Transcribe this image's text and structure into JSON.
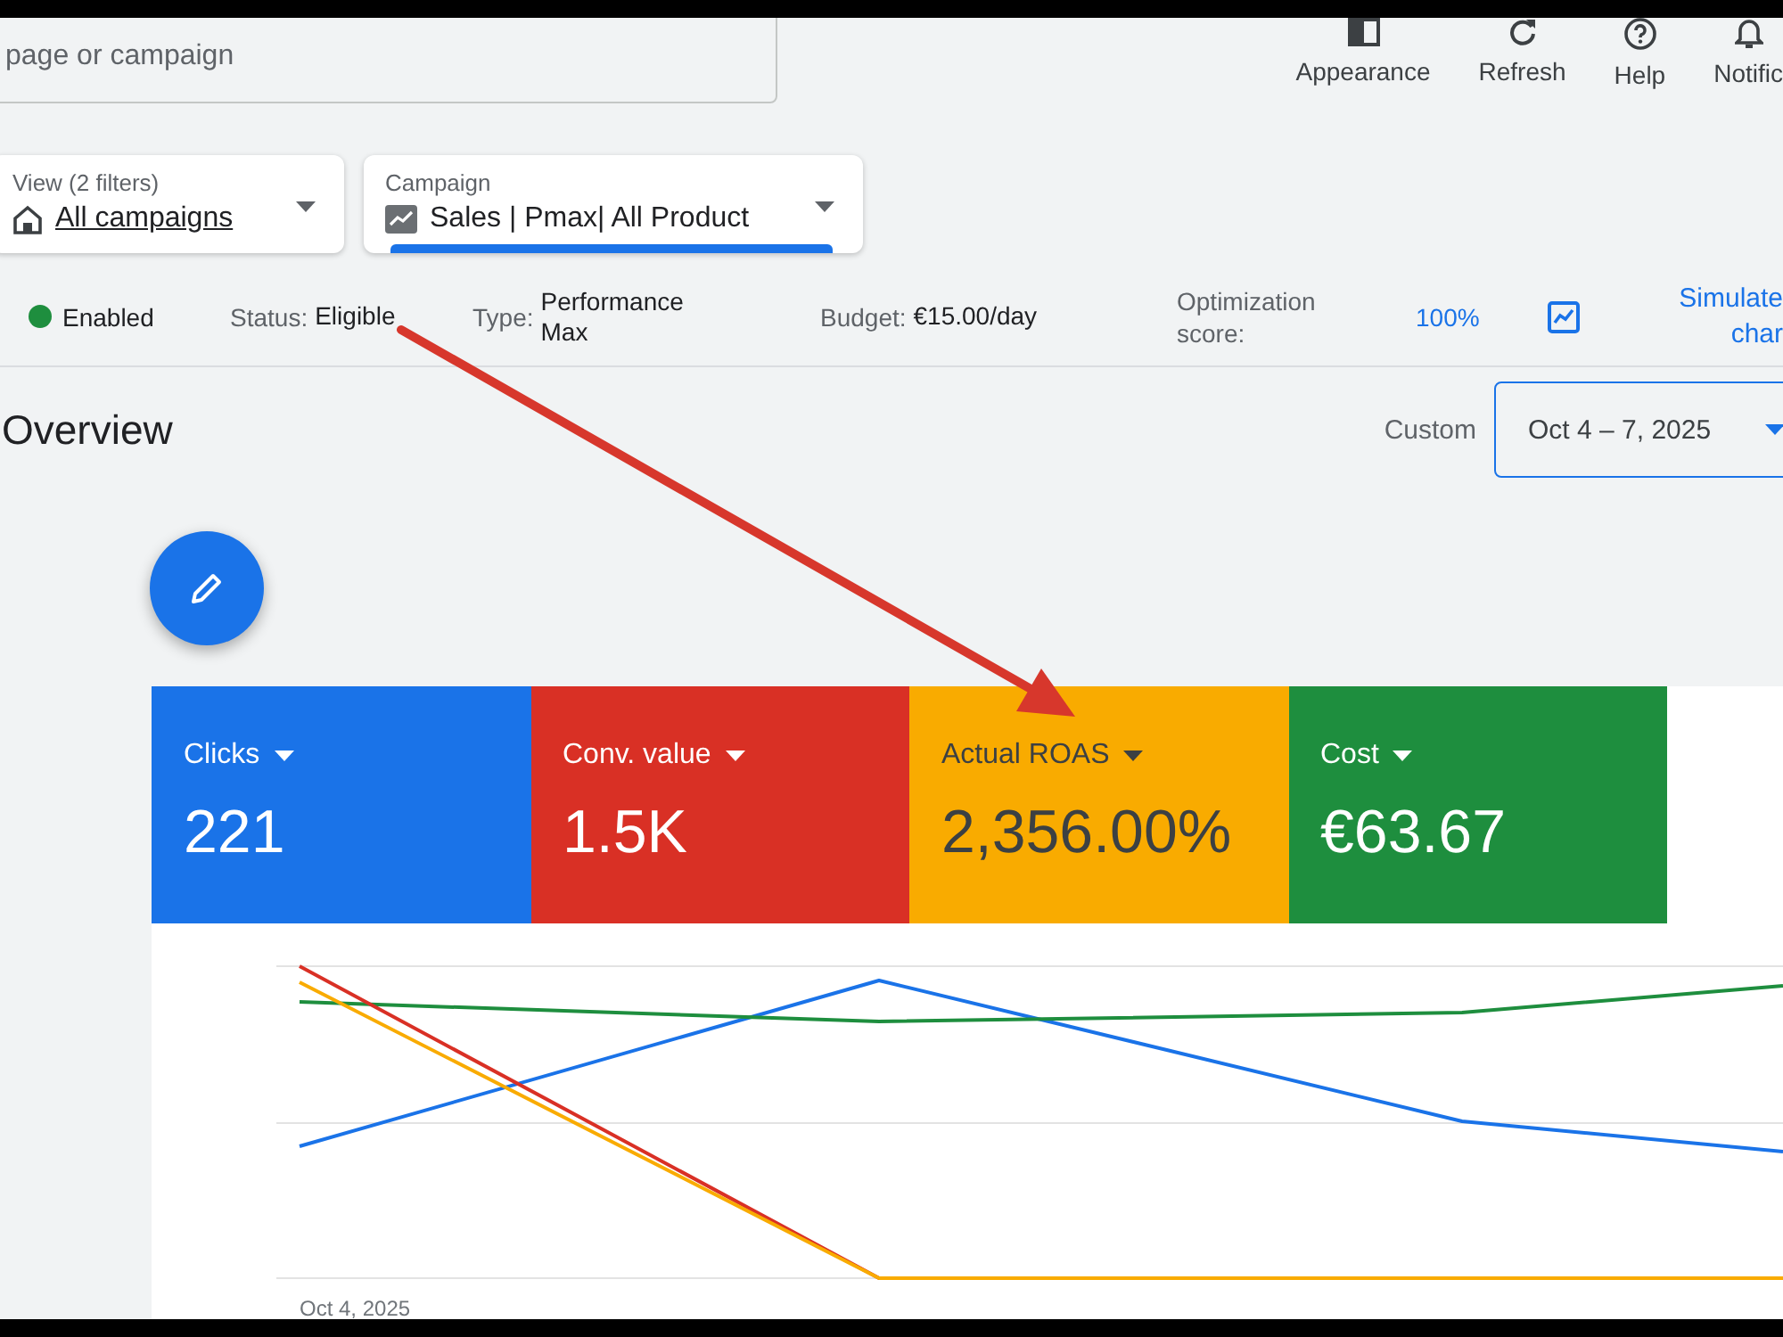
{
  "search": {
    "placeholder": "page or campaign"
  },
  "toolbar": [
    {
      "kind": "appearance",
      "label": "Appearance"
    },
    {
      "kind": "refresh",
      "label": "Refresh"
    },
    {
      "kind": "help",
      "label": "Help"
    },
    {
      "kind": "notifications",
      "label": "Notific"
    }
  ],
  "filters": [
    {
      "kind": "view",
      "label": "View (2 filters)",
      "value": "All campaigns",
      "active": false
    },
    {
      "kind": "campaign",
      "label": "Campaign",
      "value": "Sales | Pmax| All Product",
      "active": true
    }
  ],
  "campaign_info": {
    "status": {
      "label": "Enabled",
      "on": true
    },
    "fields": [
      {
        "label": "Status:",
        "value": "Eligible"
      },
      {
        "label": "Type:",
        "value": "Performance Max"
      },
      {
        "label": "Budget:",
        "value": "€15.00/day"
      }
    ],
    "optimization": {
      "label": "Optimization score:",
      "value": "100%"
    },
    "simulate": {
      "lines": [
        "Simulate",
        "char"
      ]
    }
  },
  "overview": {
    "title": "Overview",
    "date_range": {
      "label": "Custom",
      "value": "Oct 4 – 7, 2025",
      "focused": true
    }
  },
  "metrics": [
    {
      "label": "Clicks",
      "value": "221",
      "color": "#1a73e8",
      "selected": true
    },
    {
      "label": "Conv. value",
      "value": "1.5K",
      "color": "#d93025",
      "selected": true
    },
    {
      "label": "Actual ROAS",
      "value": "2,356.00%",
      "color": "#f9ab00",
      "selected": true
    },
    {
      "label": "Cost",
      "value": "€63.67",
      "color": "#1e8e3e",
      "selected": true
    }
  ],
  "chart": {
    "x_label": "Oct 4, 2025"
  }
}
